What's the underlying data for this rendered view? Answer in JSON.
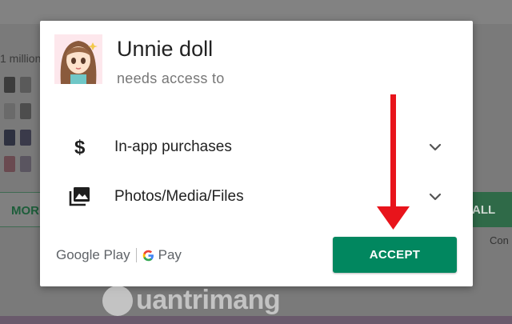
{
  "background": {
    "left_text": "1 million",
    "more_label": "MOR",
    "all_label": "ALL",
    "con_text": "Con"
  },
  "dialog": {
    "app_name": "Unnie doll",
    "subtitle": "needs access to",
    "permissions": [
      {
        "label": "In-app purchases",
        "icon": "dollar-icon"
      },
      {
        "label": "Photos/Media/Files",
        "icon": "photos-icon"
      }
    ],
    "footer": {
      "google_play": "Google Play",
      "gpay": "Pay"
    },
    "accept_label": "ACCEPT"
  },
  "watermark": {
    "text": "uantrimang"
  },
  "colors": {
    "accept": "#01875f",
    "arrow": "#e8141b",
    "overlay": "#7a7a7a"
  }
}
